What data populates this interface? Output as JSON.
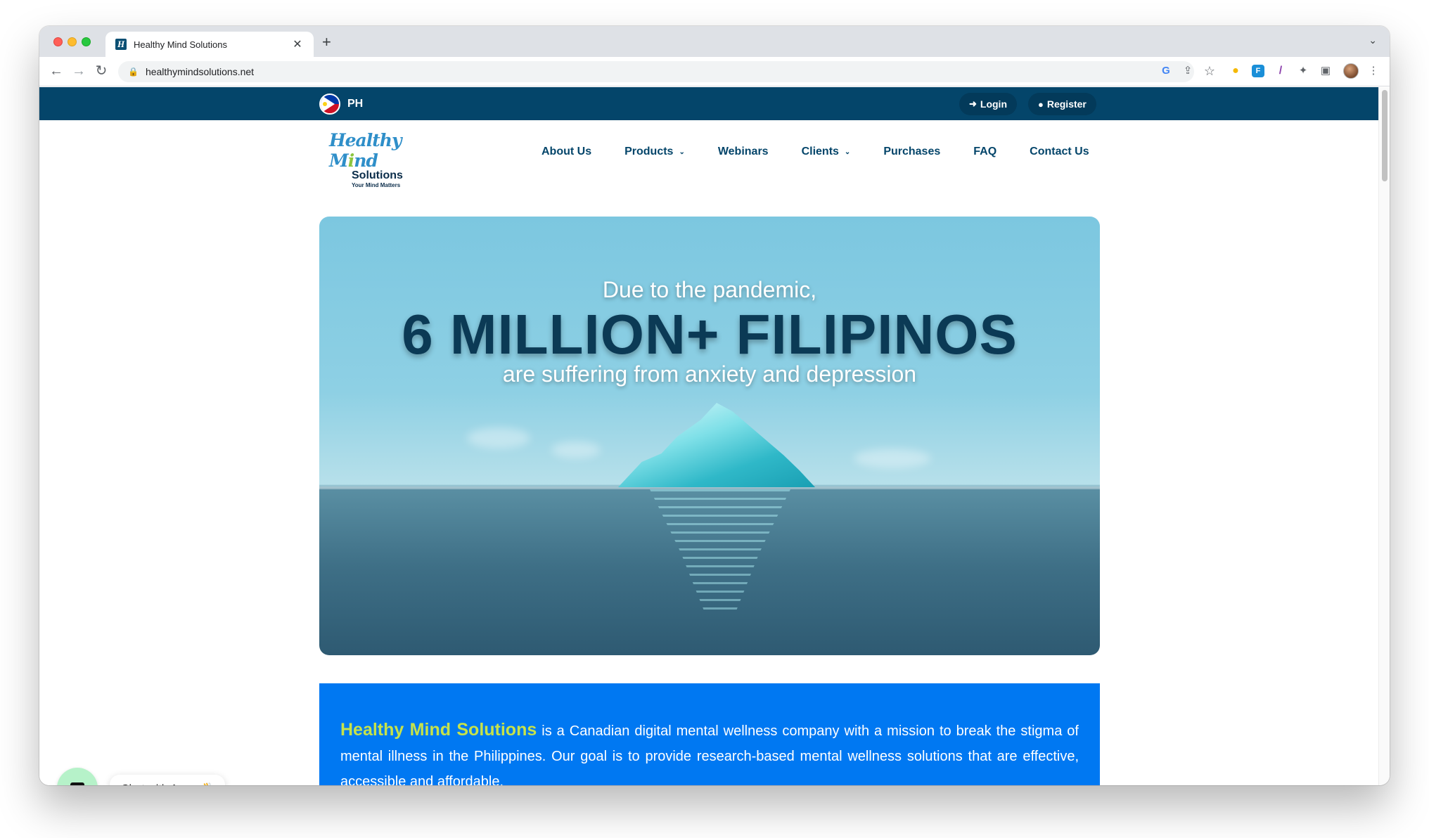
{
  "browser": {
    "tab_title": "Healthy Mind Solutions",
    "tab_favicon": "H",
    "close_glyph": "✕",
    "new_tab_glyph": "+",
    "tabs_dropdown_glyph": "⌄",
    "url": "healthymindsolutions.net",
    "lock_glyph": "🔒",
    "back_glyph": "←",
    "forward_glyph": "→",
    "reload_glyph": "↻",
    "google_glyph": "G",
    "share_glyph": "⇪",
    "star_glyph": "☆",
    "puzzle_glyph": "✦",
    "sidebar_glyph": "▣",
    "menu_glyph": "⋮",
    "ext_bulb_glyph": "●",
    "ext_blue_glyph": "F",
    "ext_pen_glyph": "/"
  },
  "topbar": {
    "country_code": "PH",
    "login_label": "Login",
    "register_label": "Register",
    "login_icon": "➜",
    "register_icon": "●",
    "bg_color": "#04456a"
  },
  "logo": {
    "line1_a": "Healthy M",
    "line1_b": "i",
    "line1_c": "nd",
    "line2": "Solutions",
    "tagline": "Your Mind Matters"
  },
  "nav": {
    "items": [
      {
        "label": "About Us",
        "caret": ""
      },
      {
        "label": "Products",
        "caret": "⌄"
      },
      {
        "label": "Webinars",
        "caret": ""
      },
      {
        "label": "Clients",
        "caret": "⌄"
      },
      {
        "label": "Purchases",
        "caret": ""
      },
      {
        "label": "FAQ",
        "caret": ""
      },
      {
        "label": "Contact Us",
        "caret": ""
      }
    ]
  },
  "hero": {
    "line1": "Due to the pandemic,",
    "line2": "6 MILLION+ FILIPINOS",
    "line3": "are suffering from anxiety and depression"
  },
  "info": {
    "brand": "Healthy Mind Solutions",
    "text": " is a Canadian digital mental wellness company with a mission to break the stigma of mental illness in the Philippines. Our goal is to provide research-based mental wellness solutions that are effective, accessible and affordable.",
    "bg_color": "#0078f2",
    "brand_color": "#c6e24a"
  },
  "chat": {
    "label": "Chat with Anna 👋",
    "button_color": "#b6f2c9"
  }
}
